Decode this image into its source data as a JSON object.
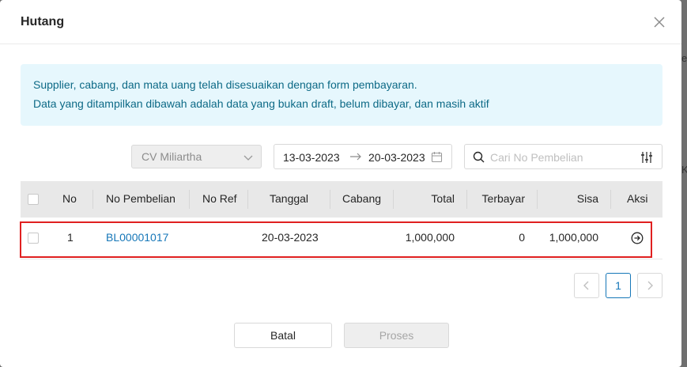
{
  "background": {
    "fragments": [
      "el",
      "Ke"
    ]
  },
  "modal": {
    "title": "Hutang",
    "info_lines": [
      "Supplier, cabang, dan mata uang telah disesuaikan dengan form pembayaran.",
      "Data yang ditampilkan dibawah adalah data yang bukan draft, belum dibayar, dan masih aktif"
    ]
  },
  "filters": {
    "supplier": "CV Miliartha",
    "date_start": "13-03-2023",
    "date_end": "20-03-2023",
    "search_placeholder": "Cari No Pembelian"
  },
  "table": {
    "columns": [
      "No",
      "No Pembelian",
      "No Ref",
      "Tanggal",
      "Cabang",
      "Total",
      "Terbayar",
      "Sisa",
      "Aksi"
    ],
    "rows": [
      {
        "no": "1",
        "no_pembelian": "BL00001017",
        "no_ref": "",
        "tanggal": "20-03-2023",
        "cabang": "",
        "total": "1,000,000",
        "terbayar": "0",
        "sisa": "1,000,000"
      }
    ]
  },
  "pagination": {
    "current_page": "1"
  },
  "buttons": {
    "cancel": "Batal",
    "proses": "Proses"
  },
  "colors": {
    "link": "#1677b8",
    "info_bg": "#e6f7fd",
    "info_text": "#0d6a86",
    "highlight": "#e02020"
  }
}
